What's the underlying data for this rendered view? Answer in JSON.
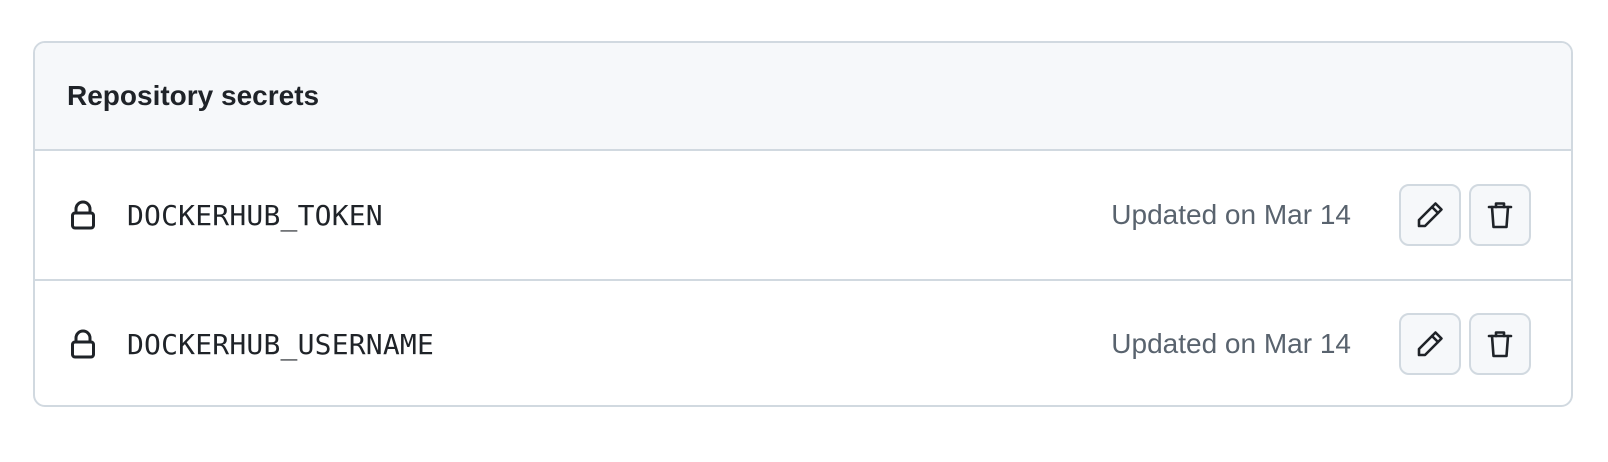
{
  "panel": {
    "title": "Repository secrets"
  },
  "secrets": [
    {
      "name": "DOCKERHUB_TOKEN",
      "updated": "Updated on Mar 14",
      "icon": "lock-icon"
    },
    {
      "name": "DOCKERHUB_USERNAME",
      "updated": "Updated on Mar 14",
      "icon": "lock-icon"
    }
  ],
  "actions": {
    "edit_icon": "pencil-icon",
    "delete_icon": "trash-icon"
  },
  "colors": {
    "border": "#d1d9e0",
    "header_bg": "#f6f8fa",
    "text": "#1f2328",
    "muted_text": "#59636e"
  }
}
